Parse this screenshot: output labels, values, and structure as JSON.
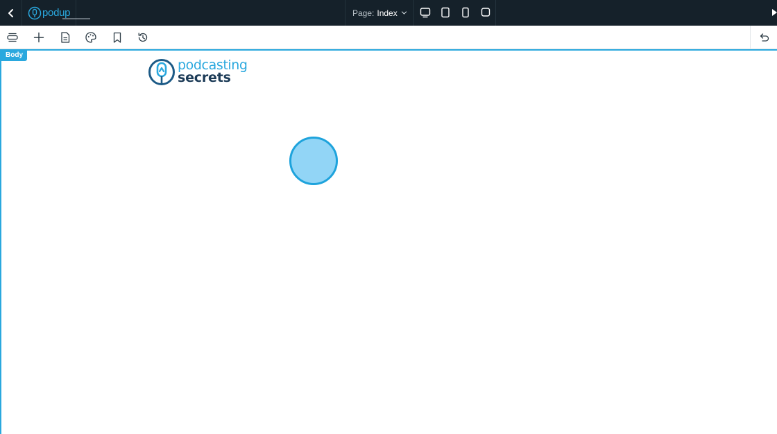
{
  "app": {
    "brand_name": "podup",
    "page_label": "Page:",
    "page_value": "Index"
  },
  "toolbar": {
    "icons": [
      "layers-icon",
      "add-icon",
      "page-icon",
      "palette-icon",
      "bookmark-icon",
      "history-icon",
      "undo-icon"
    ]
  },
  "canvas": {
    "body_tag": "Body",
    "logo_line1": "podcasting",
    "logo_line2": "secrets"
  },
  "colors": {
    "topbar_bg": "#15212a",
    "accent": "#2aa8de",
    "logo_dark": "#1c3b57",
    "cursor_fill": "#92d5f6"
  }
}
